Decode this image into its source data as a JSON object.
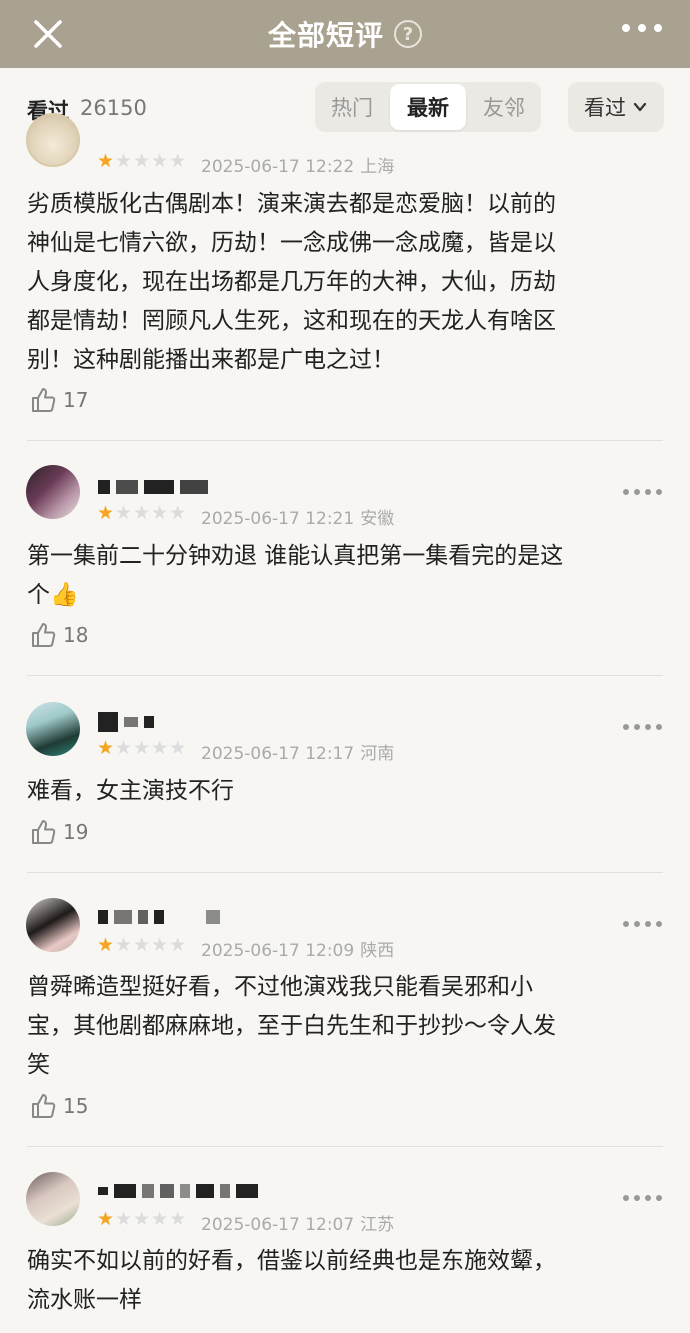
{
  "header": {
    "title": "全部短评",
    "help_icon": "?",
    "close_icon": "close-icon",
    "more_icon": "more-icon"
  },
  "subheader": {
    "seen_label": "看过",
    "seen_count": "26150",
    "tabs": [
      {
        "label": "热门",
        "active": false
      },
      {
        "label": "最新",
        "active": true
      },
      {
        "label": "友邻",
        "active": false
      }
    ],
    "filter_label": "看过",
    "filter_icon": "chevron-down-icon"
  },
  "colors": {
    "header_bg": "#aaa290",
    "star": "#f5a524",
    "page_bg": "#f7f6f3"
  },
  "reviews": [
    {
      "rating": 1,
      "time": "2025-06-17 12:22",
      "location": "上海",
      "lines": [
        "劣质模版化古偶剧本！演来演去都是恋爱脑！以前的",
        "神仙是七情六欲，历劫！一念成佛一念成魔，皆是以",
        "人身度化，现在出场都是几万年的大神，大仙，历劫",
        "都是情劫！罔顾凡人生死，这和现在的天龙人有啥区",
        "别！这种剧能播出来都是广电之过！"
      ],
      "likes": "17"
    },
    {
      "rating": 1,
      "time": "2025-06-17 12:21",
      "location": "安徽",
      "lines": [
        "第一集前二十分钟劝退 谁能认真把第一集看完的是这",
        "个👍"
      ],
      "likes": "18"
    },
    {
      "rating": 1,
      "time": "2025-06-17 12:17",
      "location": "河南",
      "lines": [
        "难看，女主演技不行"
      ],
      "likes": "19"
    },
    {
      "rating": 1,
      "time": "2025-06-17 12:09",
      "location": "陕西",
      "lines": [
        "曾舜晞造型挺好看，不过他演戏我只能看吴邪和小",
        "宝，其他剧都麻麻地，至于白先生和于抄抄～令人发",
        "笑"
      ],
      "likes": "15"
    },
    {
      "rating": 1,
      "time": "2025-06-17 12:07",
      "location": "江苏",
      "lines": [
        "确实不如以前的好看，借鉴以前经典也是东施效颦，",
        "流水账一样"
      ],
      "likes": ""
    }
  ]
}
